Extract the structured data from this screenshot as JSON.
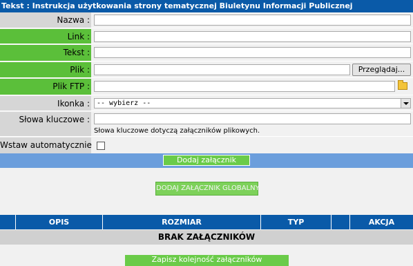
{
  "window_title": "Tekst : Instrukcja użytkowania strony tematycznej Biuletynu Informacji Publicznej",
  "form": {
    "nazwa_label": "Nazwa :",
    "link_label": "Link :",
    "tekst_label": "Tekst :",
    "plik_label": "Plik :",
    "browse_label": "Przeglądaj...",
    "plik_ftp_label": "Plik FTP :",
    "ikonka_label": "Ikonka :",
    "ikonka_selected": "-- wybierz --",
    "slowa_label": "Słowa kluczowe :",
    "slowa_hint": "Słowa kluczowe dotyczą załączników plikowych.",
    "wstaw_label": "Wstaw automatycznie :"
  },
  "buttons": {
    "add_attachment": "Dodaj załącznik",
    "add_global_attachment": "DODAJ ZAŁĄCZNIK GLOBALNY",
    "save_order": "Zapisz kolejność załączników"
  },
  "table": {
    "columns": [
      "",
      "OPIS",
      "ROZMIAR",
      "TYP",
      "",
      "AKCJA"
    ],
    "empty_message": "BRAK ZAŁĄCZNIKÓW"
  },
  "colors": {
    "header_blue": "#0a5aa8",
    "label_green": "#5bbf3a",
    "label_grey": "#d6d6d6",
    "bar_blue": "#6b9edc",
    "button_green": "#6acb49"
  },
  "icons": {
    "ftp_browse": "folder-icon",
    "select_arrow": "chevron-down-icon"
  }
}
